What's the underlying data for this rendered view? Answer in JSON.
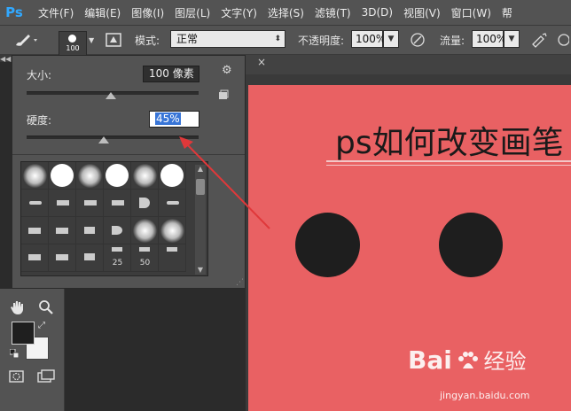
{
  "app": {
    "logo": "Ps",
    "brand_color": "#31a8ff"
  },
  "menu": [
    "文件(F)",
    "编辑(E)",
    "图像(I)",
    "图层(L)",
    "文字(Y)",
    "选择(S)",
    "滤镜(T)",
    "3D(D)",
    "视图(V)",
    "窗口(W)",
    "帮"
  ],
  "options": {
    "brush_preset_size": "100",
    "mode_label": "模式:",
    "mode_value": "正常",
    "opacity_label": "不透明度:",
    "opacity_value": "100%",
    "flow_label": "流量:",
    "flow_value": "100%"
  },
  "brush_panel": {
    "size_label": "大小:",
    "size_value": "100 像素",
    "size_fraction": 0.49,
    "hardness_label": "硬度:",
    "hardness_value": "45%",
    "hardness_fraction": 0.45,
    "tip_labels": [
      "25",
      "50"
    ]
  },
  "canvas": {
    "background_color": "#e96163",
    "title": "ps如何改变画笔"
  },
  "watermark": {
    "brand": "Bai",
    "suffix": "经验",
    "url": "jingyan.baidu.com"
  },
  "colors": {
    "foreground": "#1f1f1f",
    "background": "#f3f3f3",
    "arrow": "#e0383a"
  }
}
